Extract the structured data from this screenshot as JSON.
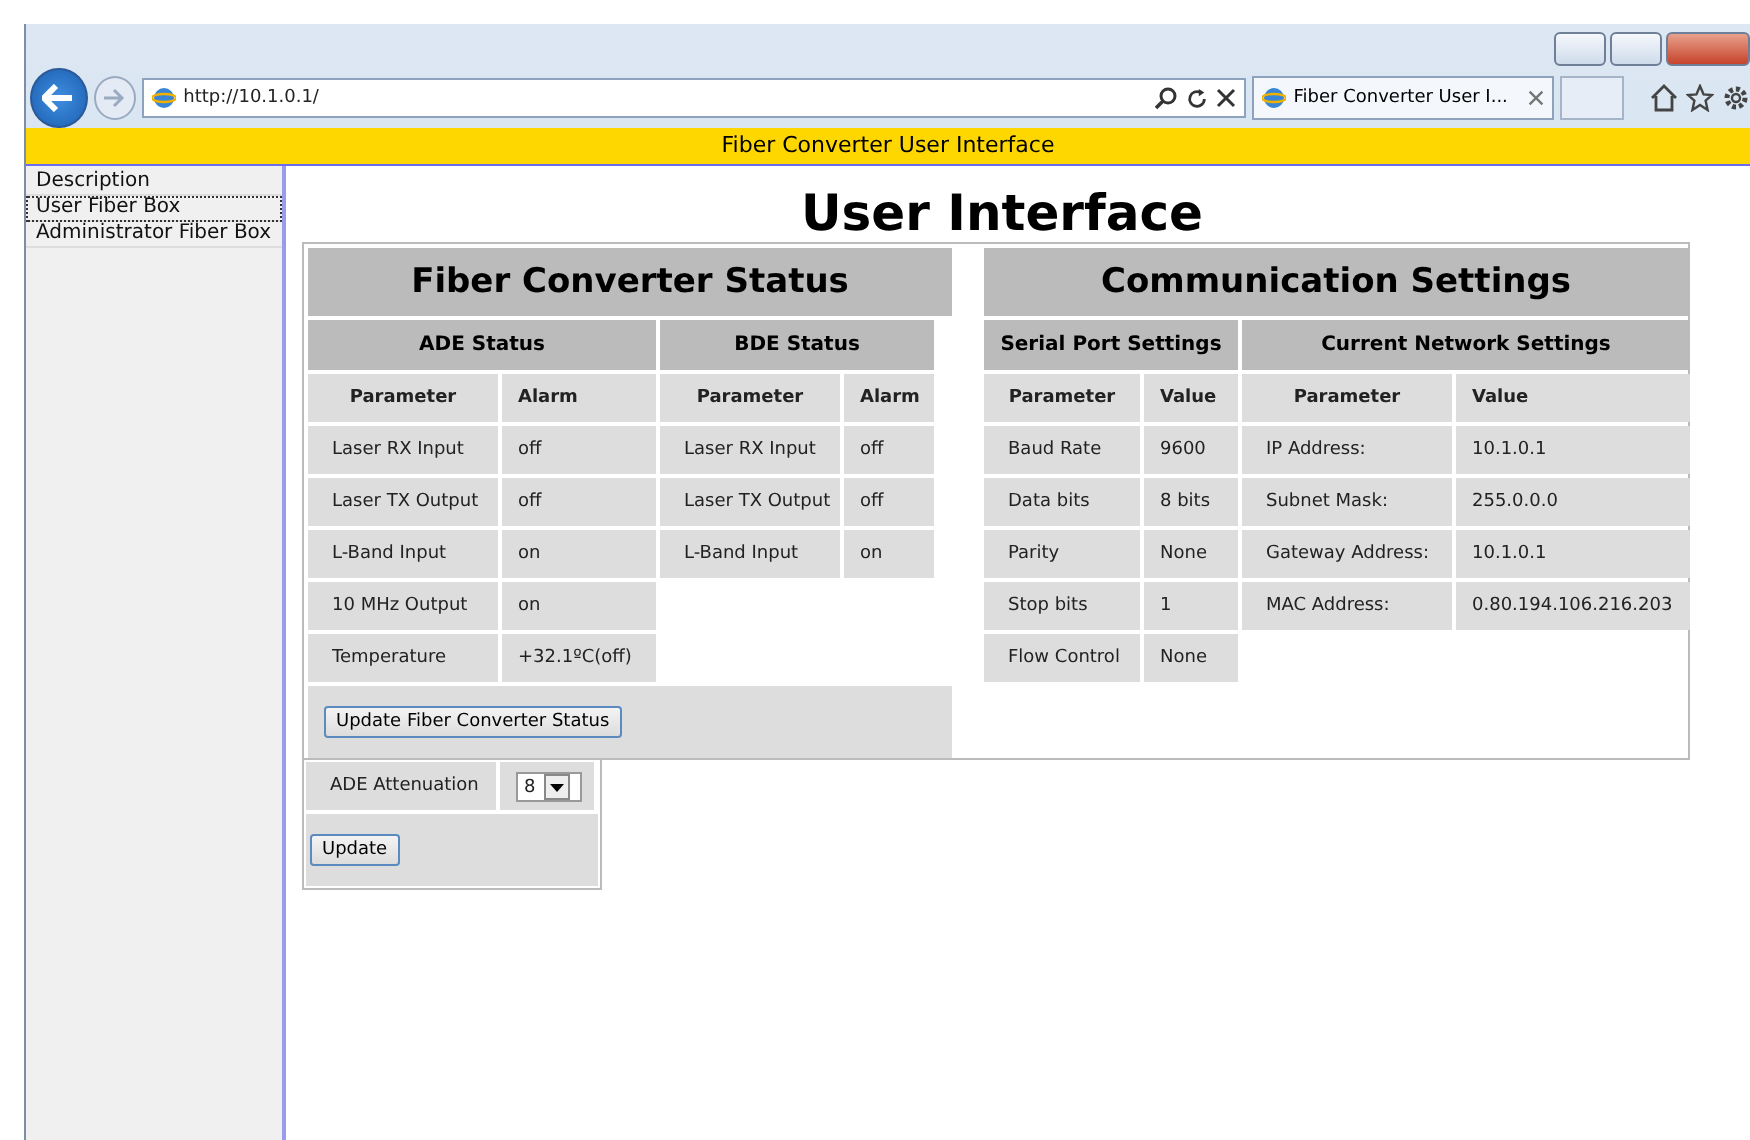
{
  "browser": {
    "url": "http://10.1.0.1/",
    "tab_title": "Fiber Converter User I..."
  },
  "banner": "Fiber Converter User Interface",
  "sidebar": {
    "items": [
      {
        "label": "Description",
        "selected": false
      },
      {
        "label": "User Fiber Box",
        "selected": true
      },
      {
        "label": "Administrator Fiber Box",
        "selected": false
      }
    ]
  },
  "heading": "User Interface",
  "status_panel": {
    "title": "Fiber Converter Status",
    "sections": [
      {
        "title": "ADE Status",
        "columns": [
          "Parameter",
          "Alarm"
        ],
        "rows": [
          [
            "Laser RX Input",
            "off"
          ],
          [
            "Laser TX Output",
            "off"
          ],
          [
            "L-Band Input",
            "on"
          ],
          [
            "10 MHz Output",
            "on"
          ],
          [
            "Temperature",
            "+32.1ºC(off)"
          ]
        ]
      },
      {
        "title": "BDE Status",
        "columns": [
          "Parameter",
          "Alarm"
        ],
        "rows": [
          [
            "Laser RX Input",
            "off"
          ],
          [
            "Laser TX Output",
            "off"
          ],
          [
            "L-Band Input",
            "on"
          ]
        ]
      }
    ],
    "button": "Update Fiber Converter Status"
  },
  "attenuation": {
    "label": "ADE Attenuation",
    "value": "8",
    "button": "Update"
  },
  "comm_panel": {
    "title": "Communication Settings",
    "sections": [
      {
        "title": "Serial Port Settings",
        "columns": [
          "Parameter",
          "Value"
        ],
        "rows": [
          [
            "Baud Rate",
            "9600"
          ],
          [
            "Data bits",
            "8 bits"
          ],
          [
            "Parity",
            "None"
          ],
          [
            "Stop bits",
            "1"
          ],
          [
            "Flow Control",
            "None"
          ]
        ]
      },
      {
        "title": "Current Network Settings",
        "columns": [
          "Parameter",
          "Value"
        ],
        "rows": [
          [
            "IP Address:",
            "10.1.0.1"
          ],
          [
            "Subnet Mask:",
            "255.0.0.0"
          ],
          [
            "Gateway Address:",
            "10.1.0.1"
          ],
          [
            "MAC Address:",
            "0.80.194.106.216.203"
          ]
        ]
      }
    ]
  }
}
